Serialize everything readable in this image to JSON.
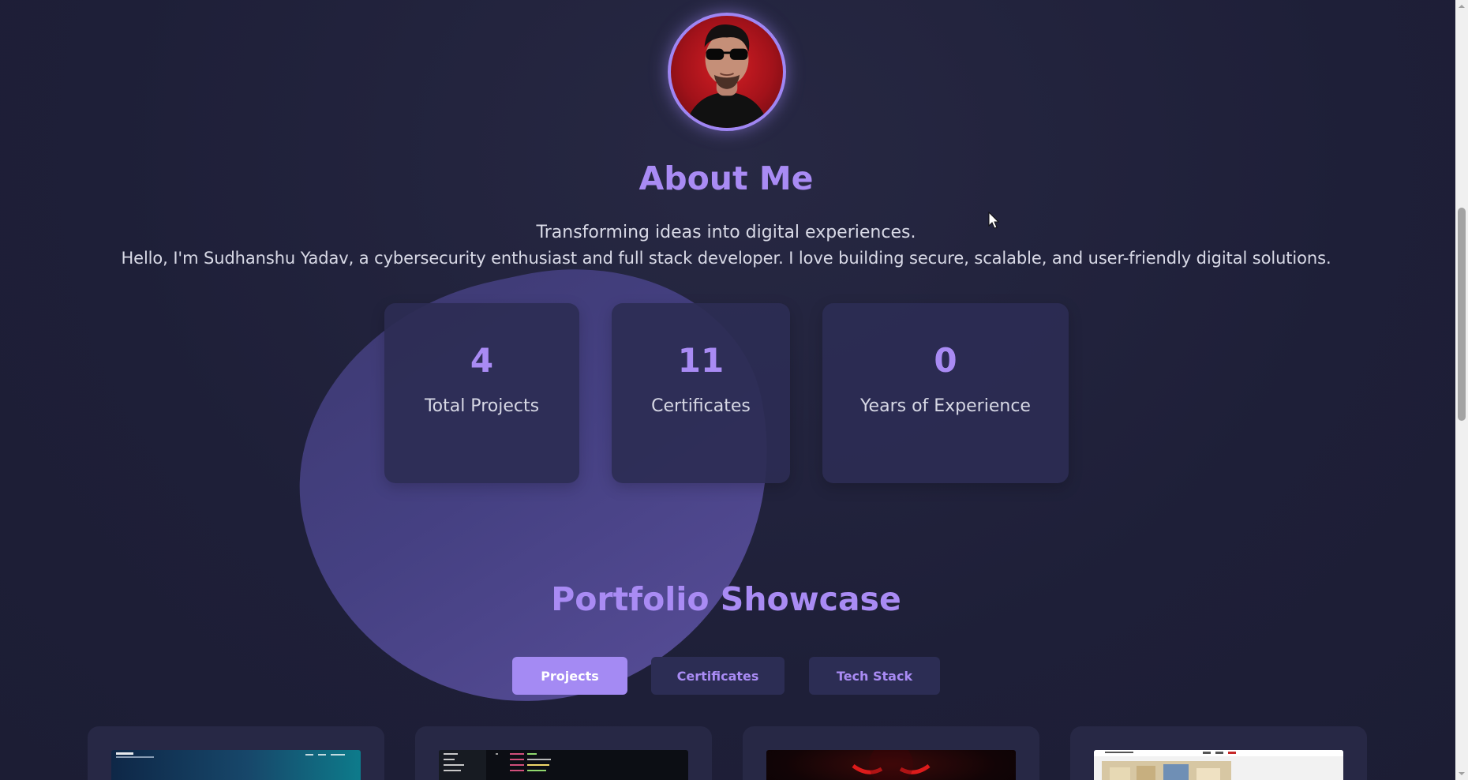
{
  "about": {
    "title": "About Me",
    "tagline": "Transforming ideas into digital experiences.",
    "intro": "Hello, I'm Sudhanshu Yadav, a cybersecurity enthusiast and full stack developer. I love building secure, scalable, and user-friendly digital solutions."
  },
  "stats": [
    {
      "value": "4",
      "label": "Total Projects"
    },
    {
      "value": "11",
      "label": "Certificates"
    },
    {
      "value": "0",
      "label": "Years of Experience"
    }
  ],
  "portfolio": {
    "title": "Portfolio Showcase",
    "tabs": [
      {
        "label": "Projects",
        "active": true
      },
      {
        "label": "Certificates",
        "active": false
      },
      {
        "label": "Tech Stack",
        "active": false
      }
    ]
  },
  "colors": {
    "background": "#1e1f38",
    "accent": "#a98bf4",
    "active_tab": "#a48af3",
    "card": "#2c2d54"
  }
}
